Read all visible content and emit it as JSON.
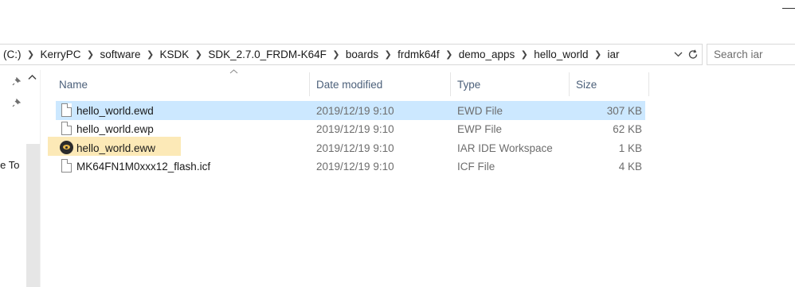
{
  "address": {
    "crumbs": [
      "(C:)",
      "KerryPC",
      "software",
      "KSDK",
      "SDK_2.7.0_FRDM-K64F",
      "boards",
      "frdmk64f",
      "demo_apps",
      "hello_world",
      "iar"
    ],
    "separator": "❯",
    "dropdown_icon": "chevron-down-icon",
    "refresh_icon": "refresh-icon"
  },
  "search": {
    "placeholder": "Search iar"
  },
  "nav": {
    "partial_label": "ule To"
  },
  "columns": {
    "name": "Name",
    "date": "Date modified",
    "type": "Type",
    "size": "Size"
  },
  "files": [
    {
      "name": "hello_world.ewd",
      "date": "2019/12/19 9:10",
      "type": "EWD File",
      "size": "307 KB",
      "icon": "document-icon",
      "selected": true
    },
    {
      "name": "hello_world.ewp",
      "date": "2019/12/19 9:10",
      "type": "EWP File",
      "size": "62 KB",
      "icon": "document-icon",
      "selected": false
    },
    {
      "name": "hello_world.eww",
      "date": "2019/12/19 9:10",
      "type": "IAR IDE Workspace",
      "size": "1 KB",
      "icon": "iar-workspace-icon",
      "selected": false
    },
    {
      "name": "MK64FN1M0xxx12_flash.icf",
      "date": "2019/12/19 9:10",
      "type": "ICF File",
      "size": "4 KB",
      "icon": "document-icon",
      "selected": false
    }
  ],
  "colors": {
    "selection": "#cce8ff",
    "hover": "#fce9b7",
    "header_text": "#4c607a"
  }
}
